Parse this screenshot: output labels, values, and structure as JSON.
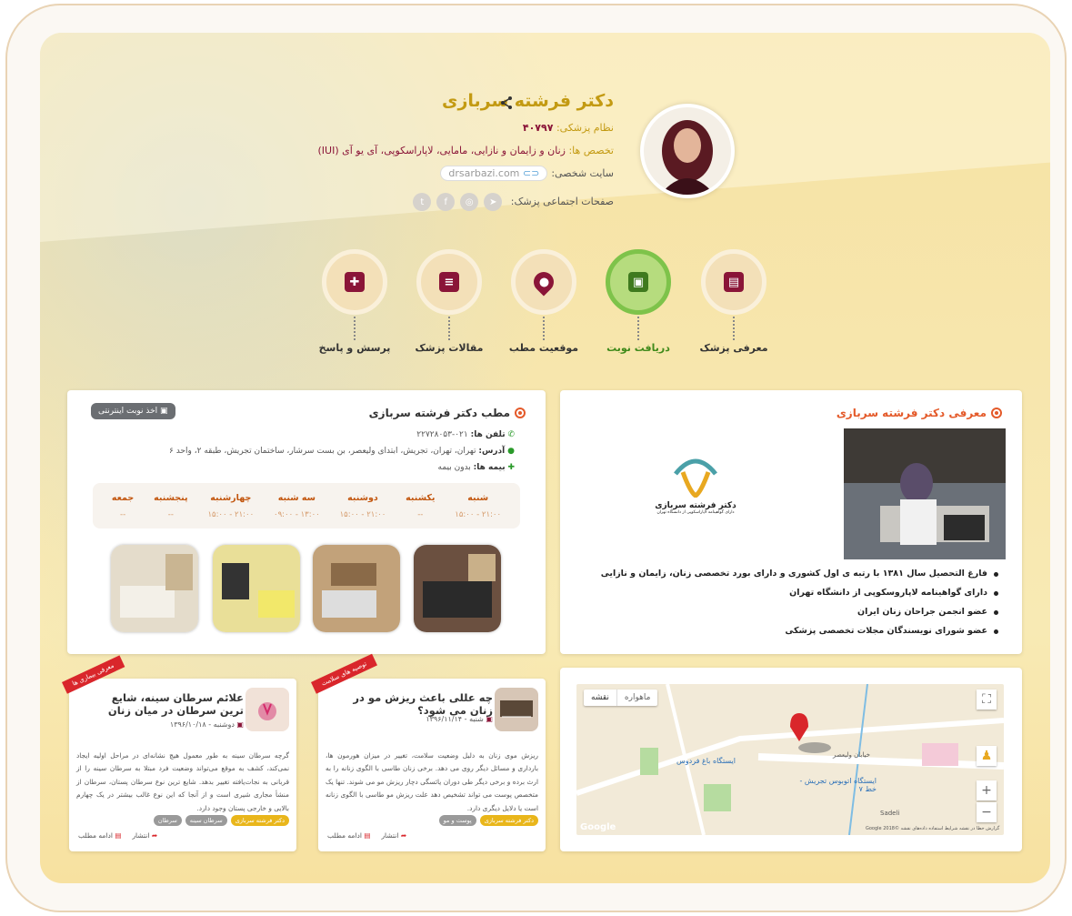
{
  "doctor": {
    "name": "دکتر فرشته سربازی",
    "medical_code_label": "نظام پزشکی:",
    "medical_code": "۴۰۷۹۷",
    "specialty_label": "تخصص ها:",
    "specialty": "زنان و زایمان و نازایی، مامایی، لاپاراسکوپی، آی یو آی (IUI)",
    "site_label": "سایت شخصی:",
    "site": "drsarbazi.com",
    "social_label": "صفحات اجتماعی پزشک:"
  },
  "nav": [
    {
      "label": "معرفی پزشک",
      "icon": "id-card-icon",
      "active": false
    },
    {
      "label": "دریافت نوبت",
      "icon": "calendar-icon",
      "active": true
    },
    {
      "label": "موقعیت مطب",
      "icon": "location-pin-icon",
      "active": false
    },
    {
      "label": "مقالات پزشک",
      "icon": "articles-icon",
      "active": false
    },
    {
      "label": "پرسش و پاسخ",
      "icon": "medical-cross-icon",
      "active": false
    }
  ],
  "office": {
    "title": "مطب دکتر فرشته سربازی",
    "online_button": "اخذ نوبت اینترنتی",
    "phone_label": "تلفن ها:",
    "phone": "۰۲۱-۲۲۷۲۸۰۵۳",
    "address_label": "آدرس:",
    "address": "تهران، تهران، تجریش، ابتدای ولیعصر، بن بست سرشار، ساختمان تجریش، طبقه ۲، واحد ۶",
    "insurance_label": "بیمه ها:",
    "insurance": "بدون بیمه",
    "schedule": [
      {
        "day": "شنبه",
        "hours": "۱۵:۰۰ - ۲۱:۰۰"
      },
      {
        "day": "یکشنبه",
        "hours": "--"
      },
      {
        "day": "دوشنبه",
        "hours": "۱۵:۰۰ - ۲۱:۰۰"
      },
      {
        "day": "سه شنبه",
        "hours": "۰۹:۰۰ - ۱۳:۰۰"
      },
      {
        "day": "چهارشنبه",
        "hours": "۱۵:۰۰ - ۲۱:۰۰"
      },
      {
        "day": "پنجشنبه",
        "hours": "--"
      },
      {
        "day": "جمعه",
        "hours": "--"
      }
    ]
  },
  "intro": {
    "title": "معرفی دکتر فرشته سربازی",
    "logo_name": "دکتر فرشته سربازی",
    "logo_sub": "دارای گواهینامه لاپاراسکوپی از دانشگاه تهران",
    "bullets": [
      "فارغ التحصیل سال ۱۳۸۱ با رتبه ی اول کشوری و دارای بورد تخصصی زنان، زایمان و نازایی",
      "دارای گواهینامه لاپاروسکوپی از دانشگاه تهران",
      "عضو انجمن جراحان زنان ایران",
      "عضو شورای نویسندگان مجلات تخصصی پزشکی"
    ]
  },
  "articles": [
    {
      "ribbon": "معرفی بیماری ها",
      "title": "علائم سرطان سینه، شایع ترین سرطان در میان زنان",
      "date": "دوشنبه - ۱۳۹۶/۱۰/۱۸",
      "body": "گرچه سرطان سینه به طور معمول هیچ نشانه‌ای در مراحل اولیه ایجاد نمی‌کند، کشف به موقع می‌تواند وضعیت فرد مبتلا به سرطان سینه را از قربانی به نجات‌یافته تغییر بدهد. شایع ترین نوع سرطان پستان، سرطان از منشأ مجاری شیری است و از آنجا که این نوع غالب بیشتر در یک چهارم بالایی و خارجی پستان وجود دارد.",
      "tags": [
        "دکتر فرشته سربازی",
        "سرطان سینه",
        "سرطان"
      ],
      "share": "انتشار",
      "more": "ادامه مطلب"
    },
    {
      "ribbon": "توصیه های سلامت",
      "title": "چه عللی باعث ریزش مو در زنان می شود؟",
      "date": "شنبه - ۱۳۹۶/۱۱/۱۴",
      "body": "ریزش موی زنان به دلیل وضعیت سلامت، تغییر در میزان هورمون ها، بارداری و مسائل دیگر روی می دهد. برخی زنان طاسی با الگوی زنانه را به ارث برده و برخی دیگر طی دوران یائسگی دچار ریزش مو می شوند. تنها یک متخصص پوست می تواند تشخیص دهد علت ریزش مو طاسی با الگوی زنانه است یا دلایل دیگری دارد.",
      "tags": [
        "دکتر فرشته سربازی",
        "پوست و مو"
      ],
      "share": "انتشار",
      "more": "ادامه مطلب"
    }
  ],
  "map": {
    "btn_map": "نقشه",
    "btn_satellite": "ماهواره",
    "label_station1": "ایستگاه باغ فردوس",
    "label_station2": "ایستگاه اتوبوس تجریش - خط ۷",
    "label_sadeli": "Sadeli",
    "label_valiasr": "خیابان ولیعصر",
    "attribution": "گزارش خطا در نقشه  شرایط استفاده  داده‌های نقشه ©2018 Google",
    "google": "Google"
  },
  "colors": {
    "brand": "#8a1538",
    "gold": "#c39a12",
    "accent": "#e45a2a",
    "green": "#7ec34a"
  }
}
